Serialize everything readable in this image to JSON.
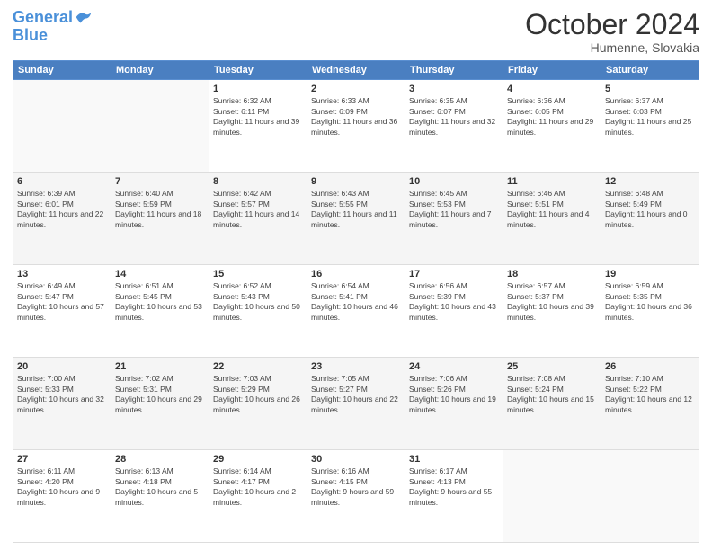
{
  "logo": {
    "line1": "General",
    "line2": "Blue"
  },
  "title": {
    "month_year": "October 2024",
    "location": "Humenne, Slovakia"
  },
  "weekdays": [
    "Sunday",
    "Monday",
    "Tuesday",
    "Wednesday",
    "Thursday",
    "Friday",
    "Saturday"
  ],
  "weeks": [
    [
      {
        "day": "",
        "info": ""
      },
      {
        "day": "",
        "info": ""
      },
      {
        "day": "1",
        "info": "Sunrise: 6:32 AM\nSunset: 6:11 PM\nDaylight: 11 hours and 39 minutes."
      },
      {
        "day": "2",
        "info": "Sunrise: 6:33 AM\nSunset: 6:09 PM\nDaylight: 11 hours and 36 minutes."
      },
      {
        "day": "3",
        "info": "Sunrise: 6:35 AM\nSunset: 6:07 PM\nDaylight: 11 hours and 32 minutes."
      },
      {
        "day": "4",
        "info": "Sunrise: 6:36 AM\nSunset: 6:05 PM\nDaylight: 11 hours and 29 minutes."
      },
      {
        "day": "5",
        "info": "Sunrise: 6:37 AM\nSunset: 6:03 PM\nDaylight: 11 hours and 25 minutes."
      }
    ],
    [
      {
        "day": "6",
        "info": "Sunrise: 6:39 AM\nSunset: 6:01 PM\nDaylight: 11 hours and 22 minutes."
      },
      {
        "day": "7",
        "info": "Sunrise: 6:40 AM\nSunset: 5:59 PM\nDaylight: 11 hours and 18 minutes."
      },
      {
        "day": "8",
        "info": "Sunrise: 6:42 AM\nSunset: 5:57 PM\nDaylight: 11 hours and 14 minutes."
      },
      {
        "day": "9",
        "info": "Sunrise: 6:43 AM\nSunset: 5:55 PM\nDaylight: 11 hours and 11 minutes."
      },
      {
        "day": "10",
        "info": "Sunrise: 6:45 AM\nSunset: 5:53 PM\nDaylight: 11 hours and 7 minutes."
      },
      {
        "day": "11",
        "info": "Sunrise: 6:46 AM\nSunset: 5:51 PM\nDaylight: 11 hours and 4 minutes."
      },
      {
        "day": "12",
        "info": "Sunrise: 6:48 AM\nSunset: 5:49 PM\nDaylight: 11 hours and 0 minutes."
      }
    ],
    [
      {
        "day": "13",
        "info": "Sunrise: 6:49 AM\nSunset: 5:47 PM\nDaylight: 10 hours and 57 minutes."
      },
      {
        "day": "14",
        "info": "Sunrise: 6:51 AM\nSunset: 5:45 PM\nDaylight: 10 hours and 53 minutes."
      },
      {
        "day": "15",
        "info": "Sunrise: 6:52 AM\nSunset: 5:43 PM\nDaylight: 10 hours and 50 minutes."
      },
      {
        "day": "16",
        "info": "Sunrise: 6:54 AM\nSunset: 5:41 PM\nDaylight: 10 hours and 46 minutes."
      },
      {
        "day": "17",
        "info": "Sunrise: 6:56 AM\nSunset: 5:39 PM\nDaylight: 10 hours and 43 minutes."
      },
      {
        "day": "18",
        "info": "Sunrise: 6:57 AM\nSunset: 5:37 PM\nDaylight: 10 hours and 39 minutes."
      },
      {
        "day": "19",
        "info": "Sunrise: 6:59 AM\nSunset: 5:35 PM\nDaylight: 10 hours and 36 minutes."
      }
    ],
    [
      {
        "day": "20",
        "info": "Sunrise: 7:00 AM\nSunset: 5:33 PM\nDaylight: 10 hours and 32 minutes."
      },
      {
        "day": "21",
        "info": "Sunrise: 7:02 AM\nSunset: 5:31 PM\nDaylight: 10 hours and 29 minutes."
      },
      {
        "day": "22",
        "info": "Sunrise: 7:03 AM\nSunset: 5:29 PM\nDaylight: 10 hours and 26 minutes."
      },
      {
        "day": "23",
        "info": "Sunrise: 7:05 AM\nSunset: 5:27 PM\nDaylight: 10 hours and 22 minutes."
      },
      {
        "day": "24",
        "info": "Sunrise: 7:06 AM\nSunset: 5:26 PM\nDaylight: 10 hours and 19 minutes."
      },
      {
        "day": "25",
        "info": "Sunrise: 7:08 AM\nSunset: 5:24 PM\nDaylight: 10 hours and 15 minutes."
      },
      {
        "day": "26",
        "info": "Sunrise: 7:10 AM\nSunset: 5:22 PM\nDaylight: 10 hours and 12 minutes."
      }
    ],
    [
      {
        "day": "27",
        "info": "Sunrise: 6:11 AM\nSunset: 4:20 PM\nDaylight: 10 hours and 9 minutes."
      },
      {
        "day": "28",
        "info": "Sunrise: 6:13 AM\nSunset: 4:18 PM\nDaylight: 10 hours and 5 minutes."
      },
      {
        "day": "29",
        "info": "Sunrise: 6:14 AM\nSunset: 4:17 PM\nDaylight: 10 hours and 2 minutes."
      },
      {
        "day": "30",
        "info": "Sunrise: 6:16 AM\nSunset: 4:15 PM\nDaylight: 9 hours and 59 minutes."
      },
      {
        "day": "31",
        "info": "Sunrise: 6:17 AM\nSunset: 4:13 PM\nDaylight: 9 hours and 55 minutes."
      },
      {
        "day": "",
        "info": ""
      },
      {
        "day": "",
        "info": ""
      }
    ]
  ]
}
